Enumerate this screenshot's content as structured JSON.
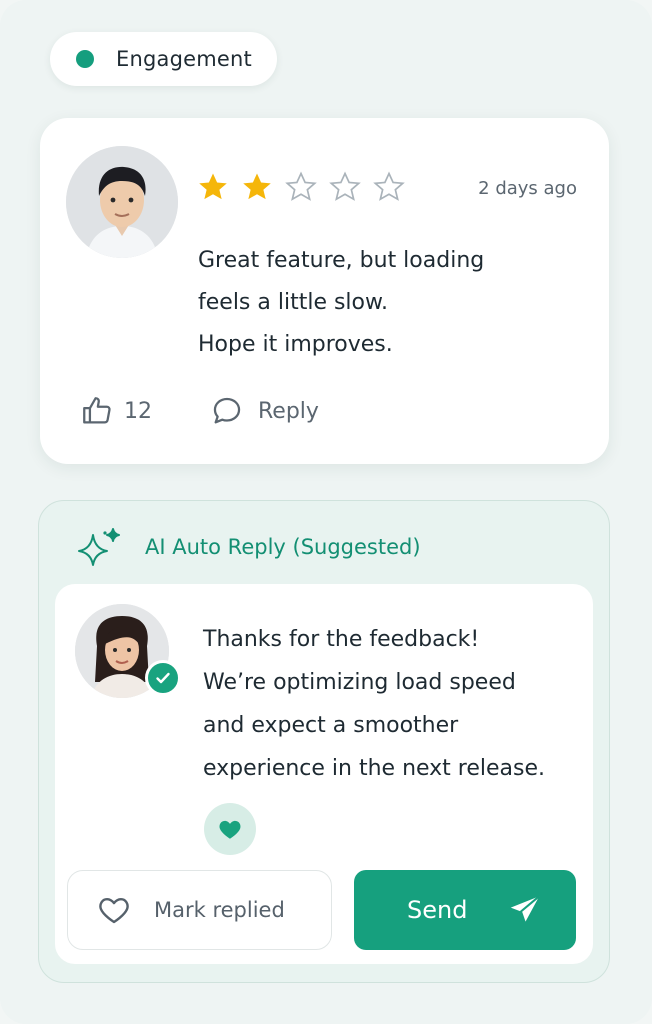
{
  "badge": {
    "label": "Engagement",
    "dot_color": "#159e7e"
  },
  "review": {
    "avatar_icon": "male-user-avatar",
    "rating": 2,
    "rating_max": 5,
    "time": "2 days ago",
    "lines": [
      "Great feature, but loading",
      "feels a little slow.",
      "Hope it improves."
    ],
    "likes": "12",
    "reply_label": "Reply"
  },
  "ai_reply": {
    "title": "AI Auto Reply (Suggested)",
    "icon": "sparkles-icon",
    "avatar_icon": "female-agent-avatar",
    "verified_icon": "check-icon",
    "lines": [
      "Thanks for the feedback!",
      "We’re optimizing load speed",
      "and expect a smoother",
      "experience in the next release."
    ],
    "reaction_icon": "heart-icon",
    "mark_replied_label": "Mark replied",
    "send_label": "Send"
  },
  "colors": {
    "accent": "#16a07e",
    "star_filled": "#f5b60a",
    "star_empty": "#aab3ba"
  }
}
